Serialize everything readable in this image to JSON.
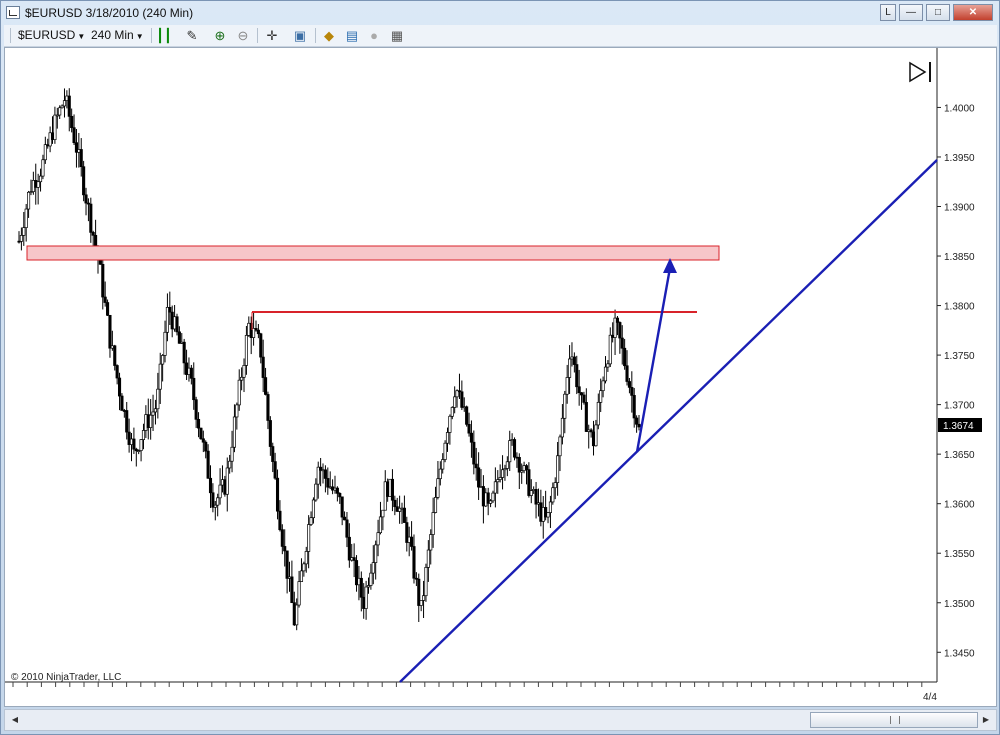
{
  "window": {
    "title": "$EURUSD  3/18/2010 (240 Min)",
    "buttons": [
      "L",
      "—",
      "□",
      "✕"
    ]
  },
  "toolbar": {
    "instrument": "$EURUSD",
    "interval": "240 Min",
    "icons": [
      "bar-chart-type-icon",
      "draw-pencil-icon",
      "zoom-in-icon",
      "zoom-out-icon",
      "crosshair-icon",
      "properties-icon",
      "strategies-icon",
      "indicators-icon",
      "disabled-circle-icon",
      "data-box-icon"
    ]
  },
  "chart": {
    "copyright": "© 2010 NinjaTrader, LLC",
    "date_label": "4/4",
    "last_price": "1.3674",
    "price_labels": [
      "1.4000",
      "1.3950",
      "1.3900",
      "1.3850",
      "1.3800",
      "1.3750",
      "1.3700",
      "1.3650",
      "1.3600",
      "1.3550",
      "1.3500",
      "1.3450"
    ],
    "play_icon": "jump-to-end-icon",
    "colors": {
      "resistance_zone": "#f4b8bc",
      "resistance_line": "#d8232a",
      "trendline": "#1a1fb4",
      "candle": "#000000",
      "last_price_bg": "#000000"
    }
  },
  "chart_data": {
    "type": "candlestick",
    "series_close_trend": [
      1.3865,
      1.392,
      1.394,
      1.398,
      1.401,
      1.396,
      1.39,
      1.384,
      1.376,
      1.37,
      1.365,
      1.368,
      1.37,
      1.38,
      1.376,
      1.372,
      1.366,
      1.36,
      1.362,
      1.37,
      1.378,
      1.376,
      1.365,
      1.356,
      1.348,
      1.356,
      1.364,
      1.362,
      1.36,
      1.354,
      1.35,
      1.356,
      1.362,
      1.36,
      1.356,
      1.349,
      1.358,
      1.366,
      1.372,
      1.368,
      1.362,
      1.359,
      1.364,
      1.366,
      1.363,
      1.36,
      1.358,
      1.365,
      1.376,
      1.37,
      1.366,
      1.374,
      1.378,
      1.373,
      1.3674
    ],
    "ylim": [
      1.342,
      1.406
    ],
    "annotations": {
      "resistance_zone": [
        1.3837,
        1.3852
      ],
      "resistance_line": 1.3787,
      "trendline": "ascending support",
      "arrow": "projection up to 1.3845"
    }
  }
}
